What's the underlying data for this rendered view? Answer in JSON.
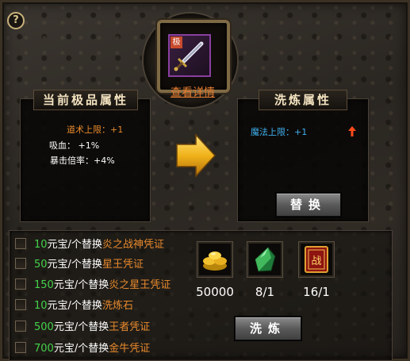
{
  "help_icon_text": "?",
  "item": {
    "badge": "极",
    "view_link": "查看详情"
  },
  "current_panel": {
    "title": "当前极品属性",
    "attrs": [
      {
        "text": "道术上限：+1",
        "color": "#e8892c"
      },
      {
        "text": "吸血：  +1%",
        "color": "#ffffff"
      },
      {
        "text": "暴击倍率：+4%",
        "color": "#ffffff"
      }
    ]
  },
  "refine_panel": {
    "title": "洗炼属性",
    "attrs": [
      {
        "text": "魔法上限：+1",
        "color": "#3fb1ef"
      }
    ],
    "up_icon": "red-up-arrow",
    "replace_button": "替换"
  },
  "options": [
    {
      "amount": "10",
      "mid": "元宝/个替换",
      "item": "炎之战神凭证"
    },
    {
      "amount": "50",
      "mid": "元宝/个替换",
      "item": "星王凭证"
    },
    {
      "amount": "150",
      "mid": "元宝/个替换",
      "item": "炎之星王凭证"
    },
    {
      "amount": "10",
      "mid": "元宝/个替换",
      "item": "洗炼石"
    },
    {
      "amount": "500",
      "mid": "元宝/个替换",
      "item": "王者凭证"
    },
    {
      "amount": "700",
      "mid": "元宝/个替换",
      "item": "金牛凭证"
    }
  ],
  "resources": [
    {
      "icon": "gold-ingots-icon",
      "count": "50000"
    },
    {
      "icon": "green-refine-stone-icon",
      "count": "8/1"
    },
    {
      "icon": "red-war-token-icon",
      "count": "16/1",
      "glyph": "战"
    }
  ],
  "refine_button": "洗炼",
  "colors": {
    "amount": "#44d24a",
    "mid_text": "#ffffff",
    "item_name": "#e8892c",
    "view_link": "#e27a2e",
    "arrow": "#f0b21a"
  }
}
